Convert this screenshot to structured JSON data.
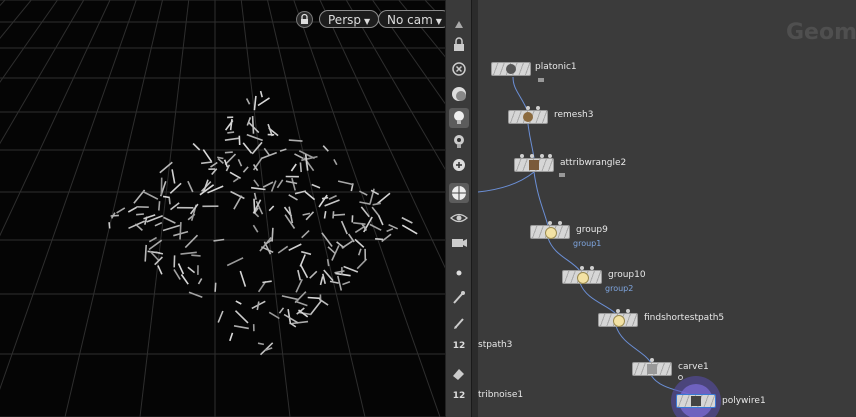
{
  "viewport": {
    "camera_menu": "Persp",
    "cam_menu": "No cam"
  },
  "network": {
    "title": "Geom",
    "nodes": [
      {
        "name": "platonic1"
      },
      {
        "name": "remesh3"
      },
      {
        "name": "attribwrangle2"
      },
      {
        "name": "group9",
        "sub": "group1"
      },
      {
        "name": "group10",
        "sub": "group2"
      },
      {
        "name": "findshortestpath5"
      },
      {
        "name": "carve1"
      },
      {
        "name": "polywire1"
      }
    ],
    "offscreen_labels": [
      "stpath3",
      "tribnoise1"
    ]
  },
  "colors": {
    "wire": "#6b8fd6",
    "accent_ring": "#7b6cd6",
    "network_bg": "#3b3b3b"
  },
  "toolbar_numbers": [
    "12",
    "12"
  ]
}
